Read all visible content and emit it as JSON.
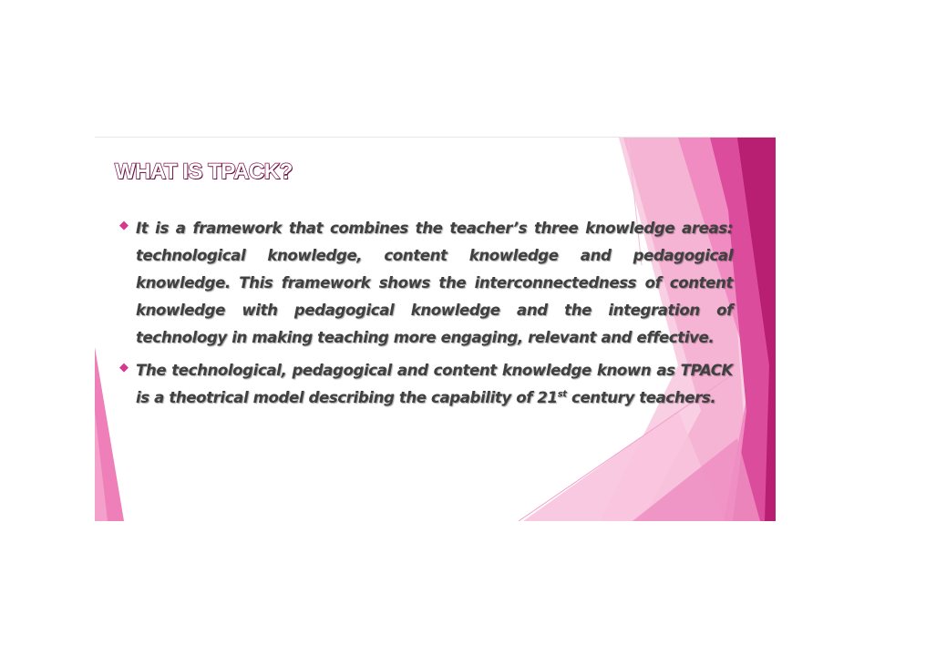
{
  "slide": {
    "title": "WHAT IS TPACK?",
    "bullets": [
      {
        "text": "It is a framework that combines the teacher’s three knowledge areas: technological knowledge, content knowledge and pedagogical knowledge. This framework shows the interconnectedness of content knowledge with pedagogical knowledge and the integration of technology in making teaching more engaging, relevant and effective."
      },
      {
        "text": "The technological, pedagogical and content knowledge known as TPACK is a theotrical model describing the capability of 21",
        "superscript": "st",
        "text_after": " century teachers."
      }
    ],
    "bullet_icon": "diamond-icon",
    "colors": {
      "title_outline": "#8b1b59",
      "bullet_marker": "#d6388f",
      "body_text": "#404040",
      "accent_dark": "#c0247a",
      "accent_light": "#f7b6d6"
    }
  }
}
